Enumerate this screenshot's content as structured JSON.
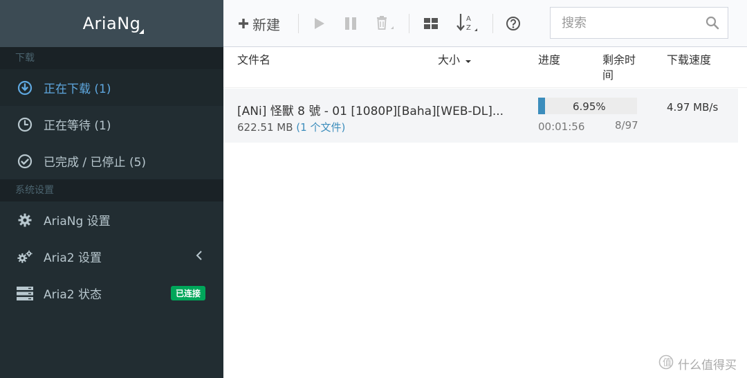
{
  "app": {
    "title": "AriaNg"
  },
  "sidebar": {
    "sections": [
      {
        "title": "下载"
      },
      {
        "title": "系统设置"
      }
    ],
    "download_items": [
      {
        "label": "正在下载 (1)",
        "icon": "download-circle-icon"
      },
      {
        "label": "正在等待 (1)",
        "icon": "clock-icon"
      },
      {
        "label": "已完成 / 已停止 (5)",
        "icon": "check-circle-icon"
      }
    ],
    "settings_items": [
      {
        "label": "AriaNg 设置",
        "icon": "gear-icon"
      },
      {
        "label": "Aria2 设置",
        "icon": "gears-icon"
      },
      {
        "label": "Aria2 状态",
        "icon": "server-icon",
        "badge": "已连接"
      }
    ]
  },
  "toolbar": {
    "new_label": "新建",
    "search_placeholder": "搜索"
  },
  "table": {
    "headers": {
      "name": "文件名",
      "size": "大小",
      "progress": "进度",
      "remaining": "剩余时\n间",
      "speed": "下载速度"
    }
  },
  "tasks": [
    {
      "name": "[ANi] 怪獸 8 號 - 01 [1080P][Baha][WEB-DL]...",
      "size": "622.51 MB",
      "files": "(1 个文件)",
      "progress_percent": 6.95,
      "progress_text": "6.95%",
      "remaining": "00:01:56",
      "connections": "8/97",
      "speed": "4.97 MB/s"
    }
  ],
  "watermark": {
    "text": "什么值得买"
  },
  "colors": {
    "sidebar_bg": "#222d32",
    "accent": "#3c8dbc",
    "badge": "#00a65a"
  }
}
